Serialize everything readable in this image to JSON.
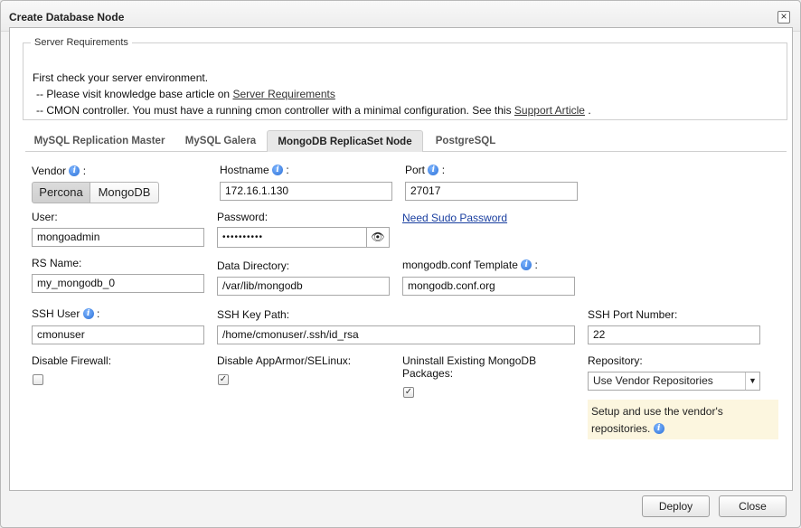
{
  "dialog": {
    "title": "Create Database Node"
  },
  "requirements": {
    "legend": "Server Requirements",
    "intro": "First check your server environment.",
    "line1_prefix": "-- Please visit knowledge base article on ",
    "line1_link": "Server Requirements",
    "line2_prefix": "-- CMON controller. You must have a running cmon controller with a minimal configuration. See this ",
    "line2_link": "Support Article",
    "line2_suffix": "."
  },
  "tabs": [
    {
      "label": "MySQL Replication Master"
    },
    {
      "label": "MySQL Galera"
    },
    {
      "label": "MongoDB ReplicaSet Node"
    },
    {
      "label": "PostgreSQL"
    }
  ],
  "form": {
    "vendor_label": "Vendor",
    "vendor_options": [
      "Percona",
      "MongoDB"
    ],
    "vendor_selected": "Percona",
    "hostname_label": "Hostname",
    "hostname_value": "172.16.1.130",
    "port_label": "Port",
    "port_value": "27017",
    "user_label": "User:",
    "user_value": "mongoadmin",
    "password_label": "Password:",
    "password_value": "••••••••••",
    "sudo_link": "Need Sudo Password",
    "rs_label": "RS Name:",
    "rs_value": "my_mongodb_0",
    "datadir_label": "Data Directory:",
    "datadir_value": "/var/lib/mongodb",
    "template_label": "mongodb.conf Template",
    "template_value": "mongodb.conf.org",
    "sshuser_label": "SSH User",
    "sshuser_value": "cmonuser",
    "sshkey_label": "SSH Key Path:",
    "sshkey_value": "/home/cmonuser/.ssh/id_rsa",
    "sshport_label": "SSH Port Number:",
    "sshport_value": "22",
    "firewall_label": "Disable Firewall:",
    "apparmor_label": "Disable AppArmor/SELinux:",
    "uninstall_label_1": "Uninstall Existing MongoDB",
    "uninstall_label_2": "Packages:",
    "repo_label": "Repository:",
    "repo_value": "Use Vendor Repositories",
    "repo_hint_1": "Setup and use the vendor's",
    "repo_hint_2": "repositories."
  },
  "buttons": {
    "deploy": "Deploy",
    "close": "Close"
  },
  "icons": {
    "info": "i",
    "check": "✓",
    "eye": "👁",
    "close": "×",
    "dropdown": "▼"
  }
}
